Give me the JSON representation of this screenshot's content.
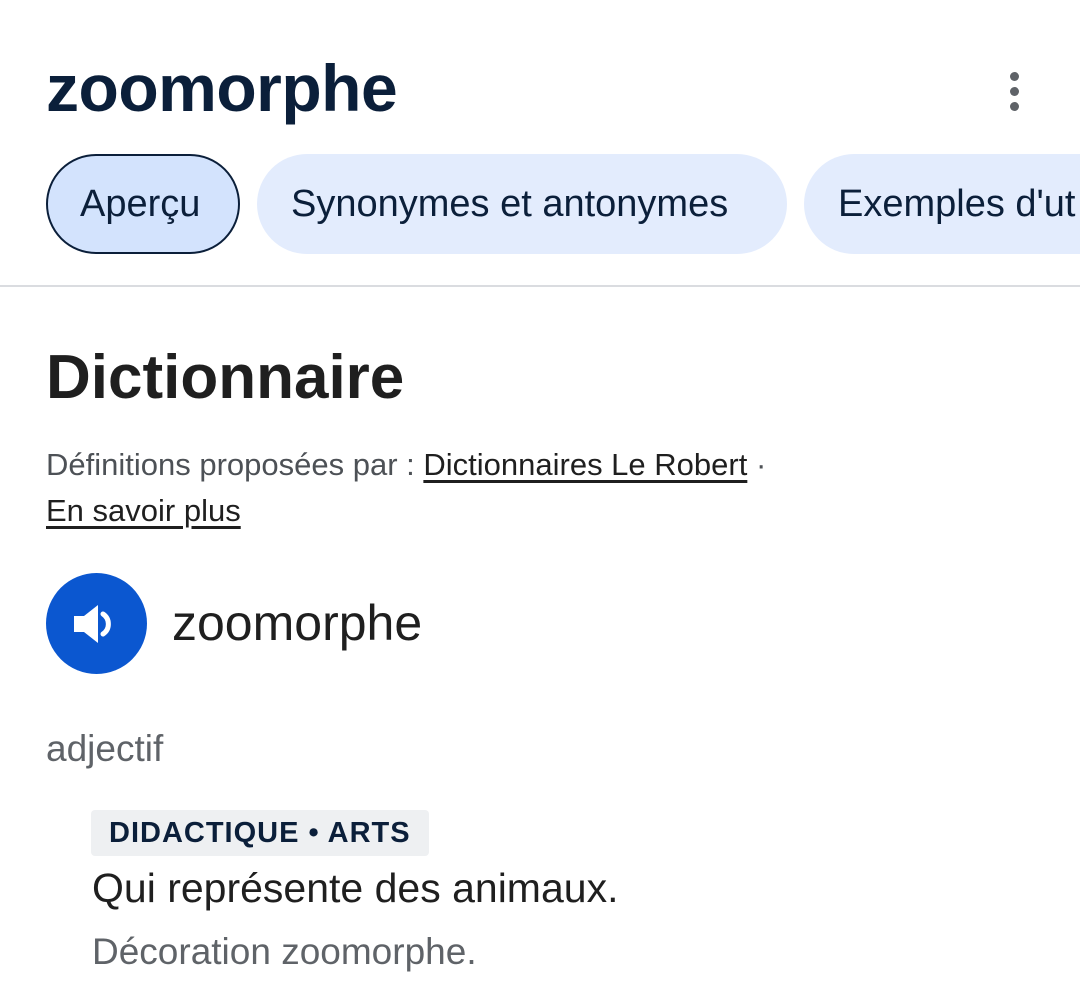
{
  "header": {
    "title": "zoomorphe"
  },
  "tabs": [
    {
      "label": "Aperçu",
      "active": true
    },
    {
      "label": "Synonymes et antonymes",
      "active": false
    },
    {
      "label": "Exemples d'ut",
      "active": false
    }
  ],
  "dictionary": {
    "title": "Dictionnaire",
    "source_prefix": "Définitions proposées par : ",
    "source_link": "Dictionnaires Le Robert",
    "separator": " · ",
    "learn_more": "En savoir plus"
  },
  "entry": {
    "audio_icon": "speaker-icon",
    "word": "zoomorphe",
    "part_of_speech": "adjectif",
    "labels": "DIDACTIQUE • ARTS",
    "definition": "Qui représente des animaux.",
    "example": "Décoration zoomorphe."
  },
  "colors": {
    "accent": "#0b57d0",
    "tab_background": "#e3ecfd",
    "title": "#0b1f3a"
  }
}
